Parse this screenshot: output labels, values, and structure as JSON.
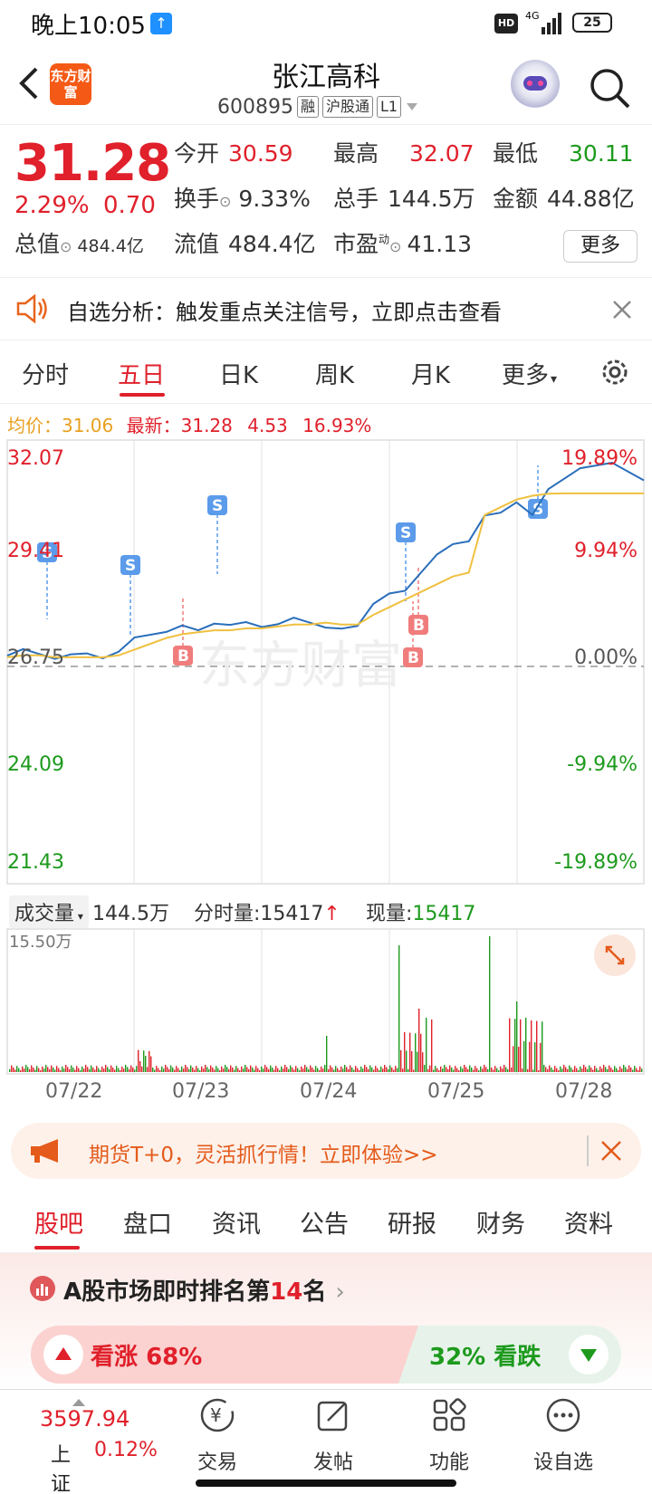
{
  "status": {
    "time": "晚上10:05",
    "network": "4G",
    "hd": "HD",
    "battery": "25"
  },
  "header": {
    "title": "张江高科",
    "code": "600895",
    "tags": [
      "融",
      "沪股通",
      "L1"
    ],
    "logo_text": "东方财富"
  },
  "quote": {
    "price": "31.28",
    "change_pct": "2.29%",
    "change": "0.70",
    "open_label": "今开",
    "open": "30.59",
    "high_label": "最高",
    "high": "32.07",
    "low_label": "最低",
    "low": "30.11",
    "turnover_label": "换手",
    "turnover": "9.33%",
    "volume_label": "总手",
    "volume": "144.5万",
    "amount_label": "金额",
    "amount": "44.88亿",
    "mcap_label": "总值",
    "mcap": "484.4亿",
    "float_label": "流值",
    "float": "484.4亿",
    "pe_label": "市盈",
    "pe_sup": "动",
    "pe": "41.13",
    "more_button": "更多"
  },
  "alert": {
    "text": "自选分析：触发重点关注信号，立即点击查看"
  },
  "chart_tabs": [
    "分时",
    "五日",
    "日K",
    "周K",
    "月K",
    "更多"
  ],
  "chart_info": {
    "avg_label": "均价：",
    "avg": "31.06",
    "latest_label": "最新：",
    "latest": "31.28",
    "diff": "4.53",
    "pct": "16.93%"
  },
  "chart_data": {
    "type": "line",
    "y_left_ticks": [
      "32.07",
      "29.41",
      "26.75",
      "24.09",
      "21.43"
    ],
    "y_right_ticks": [
      "19.89%",
      "9.94%",
      "0.00%",
      "-9.94%",
      "-19.89%"
    ],
    "ylim": [
      21.43,
      32.07
    ],
    "baseline": 26.75,
    "x_categories": [
      "07/22",
      "07/23",
      "07/24",
      "07/25",
      "07/28"
    ],
    "series": [
      {
        "values": [
          26.8,
          27.0,
          26.9,
          26.8,
          26.85,
          26.9,
          26.8,
          26.9,
          27.3,
          27.4,
          27.5,
          27.6,
          27.5,
          27.7,
          27.6,
          27.7,
          27.6,
          27.7,
          27.8,
          27.7,
          27.6,
          27.5,
          27.6,
          28.2,
          28.5,
          28.5,
          29.0,
          29.5,
          29.7,
          29.8,
          30.5,
          30.6,
          30.8,
          30.5,
          31.2,
          31.4,
          31.7,
          31.8,
          31.9,
          31.6,
          31.4
        ]
      },
      {
        "values": [
          26.8,
          26.85,
          26.85,
          26.8,
          26.8,
          26.8,
          26.8,
          26.85,
          27.0,
          27.15,
          27.3,
          27.4,
          27.45,
          27.5,
          27.5,
          27.55,
          27.55,
          27.6,
          27.65,
          27.65,
          27.7,
          27.65,
          27.65,
          27.9,
          28.1,
          28.3,
          28.5,
          28.7,
          28.9,
          29.0,
          30.5,
          30.7,
          30.9,
          31.0,
          31.05,
          31.06,
          31.06,
          31.06,
          31.06,
          31.06,
          31.06
        ]
      }
    ]
  },
  "volume": {
    "label": "成交量",
    "total": "144.5万",
    "tick_label": "分时量:",
    "tick": "15417",
    "now_label": "现量:",
    "now": "15417",
    "max": "15.50万"
  },
  "ad": {
    "text": "期货T+0，灵活抓行情！立即体验>>"
  },
  "bottom_tabs": [
    "股吧",
    "盘口",
    "资讯",
    "公告",
    "研报",
    "财务",
    "资料"
  ],
  "rank": {
    "prefix": "A股市场即时排名第",
    "num": "14",
    "suffix": "名"
  },
  "sentiment": {
    "up_label": "看涨",
    "up_pct": "68%",
    "down_pct": "32%",
    "down_label": "看跌"
  },
  "index": {
    "value": "3597.94",
    "name": "上证",
    "pct": "0.12%"
  },
  "nav": [
    "交易",
    "发帖",
    "功能",
    "设自选"
  ],
  "markers": {
    "s": "S",
    "b": "B"
  },
  "watermark": "东方财富",
  "colors": {
    "up": "#e0202b",
    "down": "#1d9a1d",
    "price_line": "#2a6ebb",
    "avg_line": "#f0c040",
    "brand": "#f45a16"
  }
}
